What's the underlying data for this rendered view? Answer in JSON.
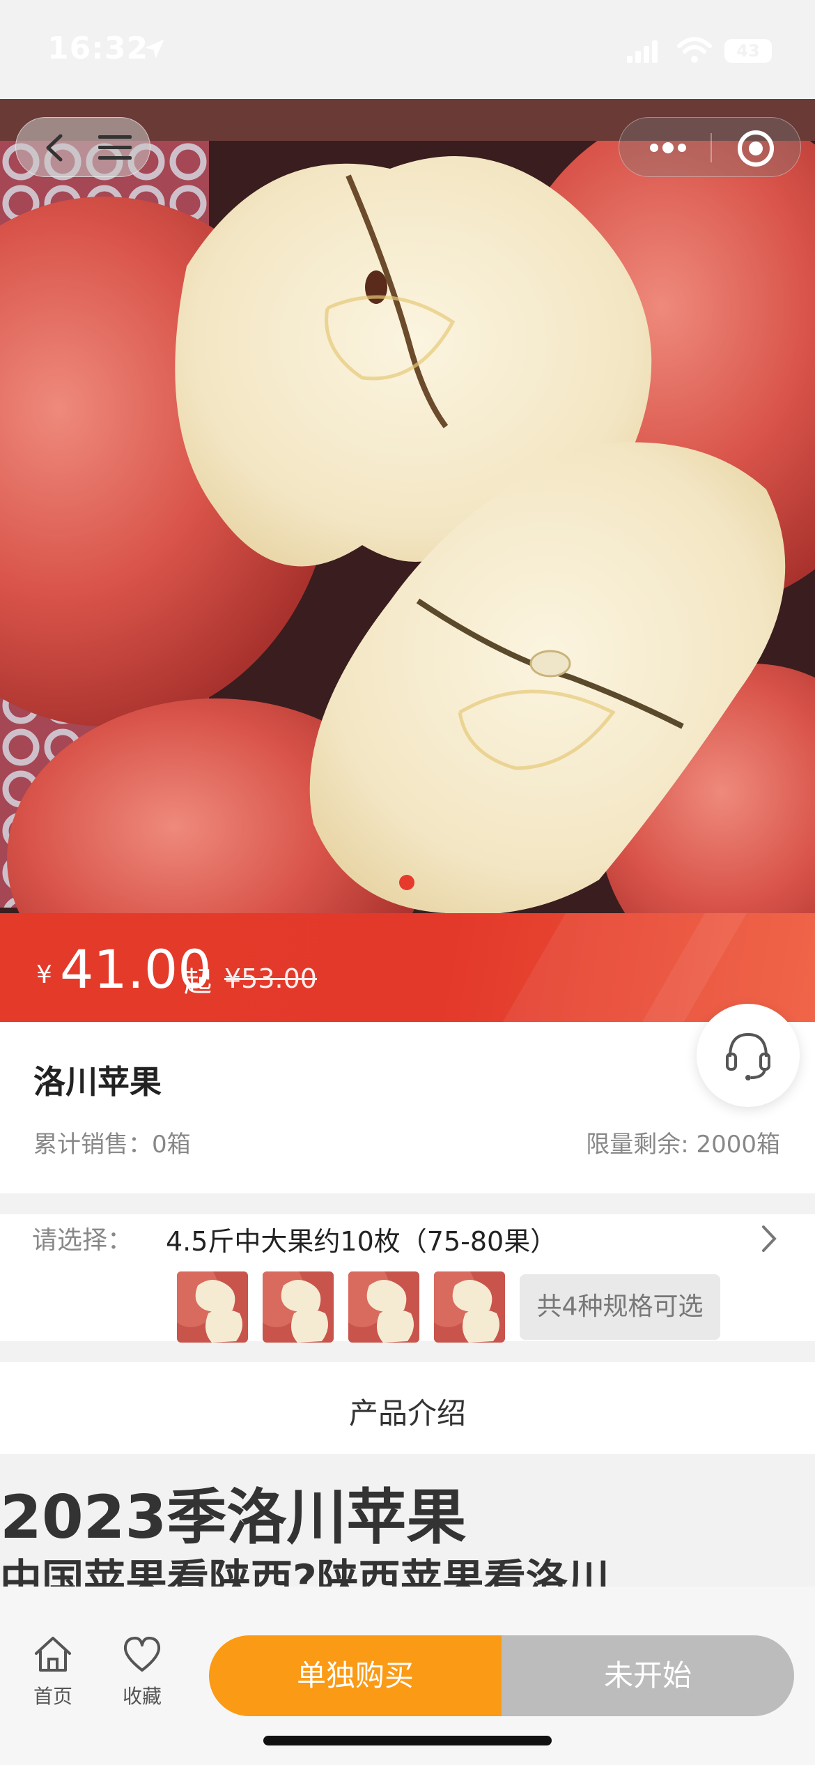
{
  "status_bar": {
    "time": "16:32",
    "battery": "43"
  },
  "hero": {
    "slide_count": 1,
    "active_slide": 1,
    "accent_color": "#e53a2c"
  },
  "price": {
    "currency": "¥",
    "current": "41.00",
    "suffix": "起",
    "original": "¥53.00",
    "bar_color": "#e3392b"
  },
  "product": {
    "title": "洛川苹果",
    "sales": "累计销售：0箱",
    "stock": "限量剩余: 2000箱"
  },
  "spec": {
    "label": "请选择：",
    "value": "4.5斤中大果约10枚（75-80果）",
    "options_count_label": "共4种规格可选",
    "thumbnails": 4
  },
  "intro": {
    "tab_label": "产品介绍",
    "heading": "2023季洛川苹果",
    "subheading": "中国苹果看陕西?陕西苹果看洛川"
  },
  "bottom_nav": {
    "home_label": "首页",
    "favorite_label": "收藏",
    "buy_alone_label": "单独购买",
    "not_started_label": "未开始",
    "buy_color": "#fb9a14",
    "disabled_color": "#bcbcbc"
  }
}
